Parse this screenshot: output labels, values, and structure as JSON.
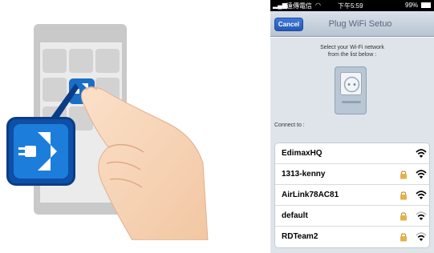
{
  "status_bar": {
    "carrier": "遠傳電信",
    "time": "下午5:59",
    "battery": "99%"
  },
  "nav": {
    "cancel_label": "Cancel",
    "title": "Plug WiFi Setuo"
  },
  "instruction": {
    "line1": "Select your Wi-Fi network",
    "line2": "from the list below :"
  },
  "connect_label": "Connect to :",
  "networks": [
    {
      "ssid": "EdimaxHQ",
      "locked": false,
      "signal": 3
    },
    {
      "ssid": "1313-kenny",
      "locked": true,
      "signal": 3
    },
    {
      "ssid": "AirLink78AC81",
      "locked": true,
      "signal": 3
    },
    {
      "ssid": "default",
      "locked": true,
      "signal": 2
    },
    {
      "ssid": "RDTeam2",
      "locked": true,
      "signal": 2
    }
  ],
  "colors": {
    "app_icon_blue": "#1d7ddb",
    "cancel_blue": "#2f68c8",
    "lock_gold": "#e3b24a"
  }
}
